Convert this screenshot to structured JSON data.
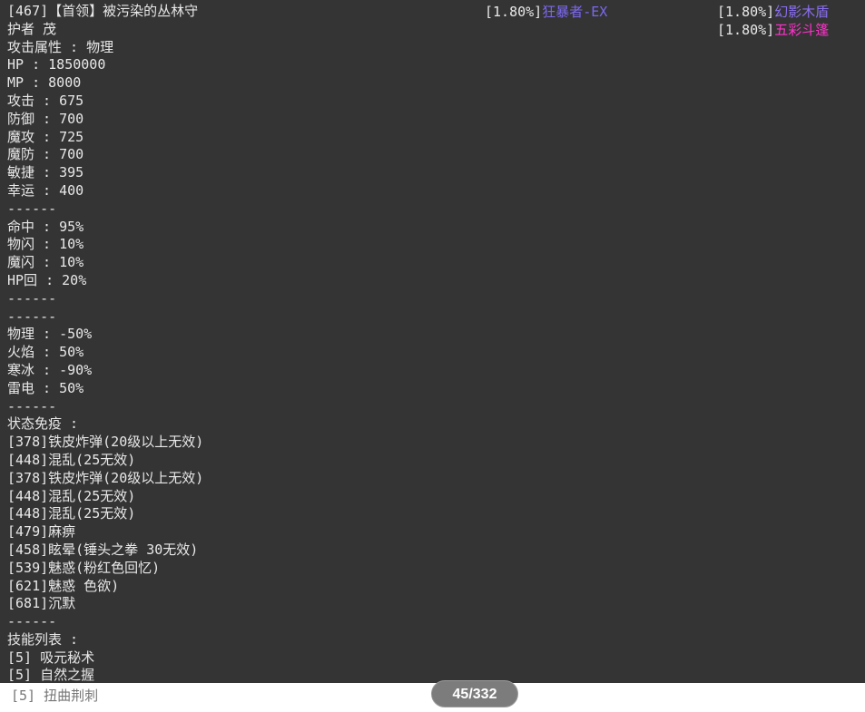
{
  "lines": [
    "[467]【首领】被污染的丛林守",
    "护者 茂",
    "攻击属性 : 物理",
    "HP : 1850000",
    "MP : 8000",
    "攻击 : 675",
    "防御 : 700",
    "魔攻 : 725",
    "魔防 : 700",
    "敏捷 : 395",
    "幸运 : 400",
    "------",
    "命中 : 95%",
    "物闪 : 10%",
    "魔闪 : 10%",
    "HP回 : 20%",
    "------",
    "------",
    "物理 : -50%",
    "火焰 : 50%",
    "寒冰 : -90%",
    "雷电 : 50%",
    "------",
    "状态免疫 :",
    "[378]铁皮炸弹(20级以上无效)",
    "[448]混乱(25无效)",
    "[378]铁皮炸弹(20级以上无效)",
    "[448]混乱(25无效)",
    "[448]混乱(25无效)",
    "[479]麻痹",
    "[458]眩晕(锤头之拳 30无效)",
    "[539]魅惑(粉红色回忆)",
    "[621]魅惑 色欲)",
    "[681]沉默",
    "------",
    "技能列表 :",
    "[5] 吸元秘术",
    "[5] 自然之握"
  ],
  "drops": [
    {
      "rate": "[1.80%]",
      "name": "狂暴者-EX",
      "color": "#7b68ee"
    },
    {
      "rate": "[1.80%]",
      "name": "幻影木盾",
      "color": "#8a6ff0"
    },
    {
      "rate": "[1.80%]",
      "name": "五彩斗篷",
      "color": "#ff33cc"
    }
  ],
  "bottom_line": "[5] 扭曲荆刺",
  "pager": "45/332"
}
